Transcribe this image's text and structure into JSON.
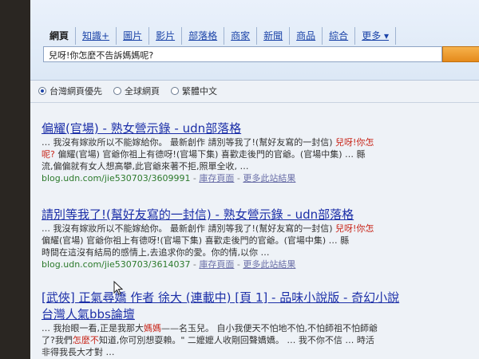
{
  "nav": {
    "tabs": [
      {
        "label": "網頁",
        "active": true
      },
      {
        "label": "知識+"
      },
      {
        "label": "圖片"
      },
      {
        "label": "影片"
      },
      {
        "label": "部落格"
      },
      {
        "label": "商家"
      },
      {
        "label": "新聞"
      },
      {
        "label": "商品"
      },
      {
        "label": "綜合"
      },
      {
        "label": "更多 ▾"
      }
    ]
  },
  "search": {
    "query": "兒呀!你怎麼不告訴媽媽呢?"
  },
  "filters": {
    "options": [
      "台灣網頁優先",
      "全球網頁",
      "繁體中文"
    ],
    "selected_index": 0
  },
  "results": [
    {
      "title": "偏耀(官場) - 熟女營示錄 - udn部落格",
      "lines": [
        [
          {
            "t": "… 我沒有嫁妝所以不能嫁給你。 最新創作 請別等我了!(幫好友寫的一封信) "
          },
          {
            "t": "兒呀!你怎",
            "h": true
          }
        ],
        [
          {
            "t": "呢?",
            "h": true
          },
          {
            "t": " 偏耀(官場) 官爺你祖上有德呀!(官場下集) 喜歡走後門的官爺。(官場中集) … 縣"
          }
        ],
        [
          {
            "t": "流,偏偏就有女人想高攀,此官爺來著不拒,照單全收, …"
          }
        ]
      ],
      "url": "blog.udn.com/jie530703/3609991",
      "cache": "庫存頁面",
      "more": "更多此站結果"
    },
    {
      "title": "請別等我了!(幫好友寫的一封信) - 熟女營示錄 - udn部落格",
      "lines": [
        [
          {
            "t": "… 我沒有嫁妝所以不能嫁給你。 最新創作 請別等我了!(幫好友寫的一封信) "
          },
          {
            "t": "兒呀!你怎",
            "h": true
          }
        ],
        [
          {
            "t": "偏耀(官場) 官爺你祖上有德呀!(官場下集) 喜歡走後門的官爺。(官場中集) … 縣"
          }
        ],
        [
          {
            "t": "時間在這沒有結局的感情上,去追求你的愛。你的情,以你 …"
          }
        ]
      ],
      "url": "blog.udn.com/jie530703/3614037",
      "cache": "庫存頁面",
      "more": "更多此站結果"
    },
    {
      "title": "[武俠] 正氣尋嬌 作者 徐大 (連載中) [頁 1] - 品味小說版 - 奇幻小說",
      "title2": "台灣人氣bbs論壇",
      "lines": [
        [
          {
            "t": "… 我抬眼一看,正是我那大"
          },
          {
            "t": "媽媽",
            "h": true
          },
          {
            "t": "——名玉兒。 自小我便天不怕地不怕,不怕師祖不怕師爺"
          }
        ],
        [
          {
            "t": "了?我們"
          },
          {
            "t": "怎麼不",
            "h": true
          },
          {
            "t": "知道,你可別想耍賴。\" 二嬤嬤人收剛回聲嬌嬌。 … 我不你不信 … 時活"
          }
        ],
        [
          {
            "t": "非得我長大才對 …"
          }
        ]
      ]
    }
  ]
}
